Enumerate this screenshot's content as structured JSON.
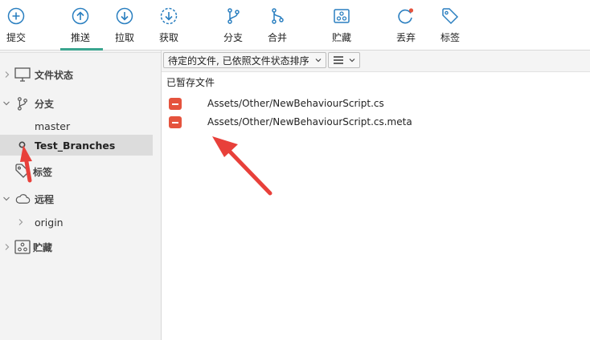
{
  "toolbar": {
    "commit": "提交",
    "push": "推送",
    "pull": "拉取",
    "fetch": "获取",
    "branch": "分支",
    "merge": "合并",
    "stash": "贮藏",
    "discard": "丢弃",
    "tag": "标签",
    "accent_color": "#3aa58f",
    "icon_color": "#2a7fc0"
  },
  "sidebar": {
    "file_status": "文件状态",
    "branches": "分支",
    "branch_items": [
      "master",
      "Test_Branches"
    ],
    "tags": "标签",
    "remotes": "远程",
    "remote_items": [
      "origin"
    ],
    "stashes": "贮藏"
  },
  "filters": {
    "sort_select": "待定的文件, 已依照文件状态排序",
    "view_menu_icon": "list-icon"
  },
  "staged": {
    "header": "已暂存文件",
    "files": [
      "Assets/Other/NewBehaviourScript.cs",
      "Assets/Other/NewBehaviourScript.cs.meta"
    ],
    "status_color": "#e5533d"
  },
  "annotation": {
    "arrow_color": "#e8403a"
  }
}
